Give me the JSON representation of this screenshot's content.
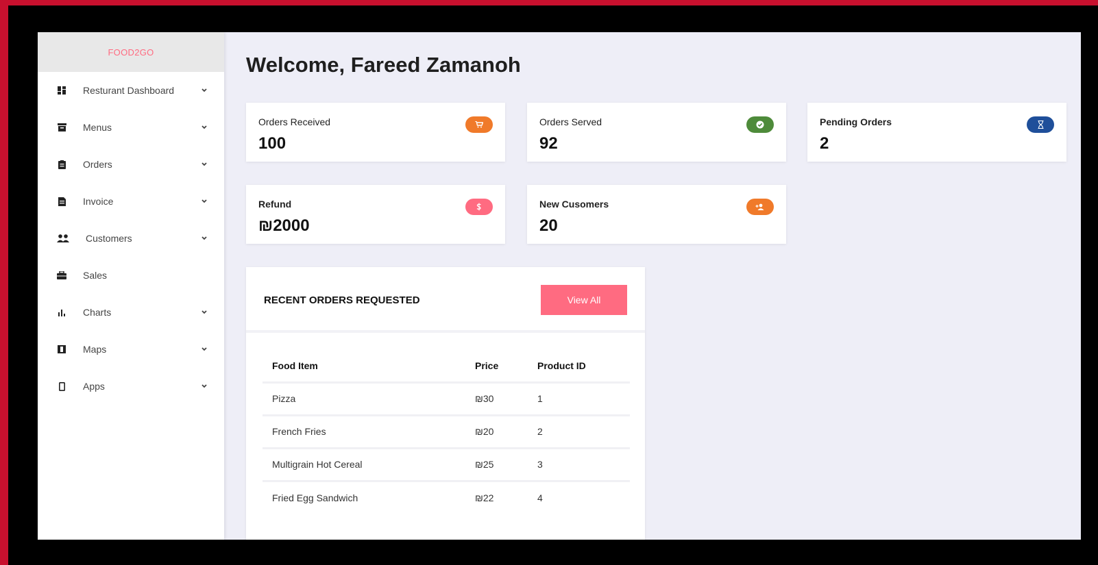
{
  "brand": "FOOD2GO",
  "sidebar": {
    "items": [
      {
        "label": "Resturant Dashboard",
        "icon": "dashboard-icon",
        "chevron": true
      },
      {
        "label": "Menus",
        "icon": "archive-icon",
        "chevron": true
      },
      {
        "label": "Orders",
        "icon": "clipboard-icon",
        "chevron": true
      },
      {
        "label": "Invoice",
        "icon": "invoice-icon",
        "chevron": true
      },
      {
        "label": "Customers",
        "icon": "users-icon",
        "chevron": true
      },
      {
        "label": "Sales",
        "icon": "briefcase-icon",
        "chevron": false
      },
      {
        "label": "Charts",
        "icon": "bar-chart-icon",
        "chevron": true
      },
      {
        "label": "Maps",
        "icon": "map-icon",
        "chevron": true
      },
      {
        "label": "Apps",
        "icon": "mobile-icon",
        "chevron": true
      }
    ]
  },
  "header": {
    "welcome": "Welcome, Fareed Zamanoh"
  },
  "stats": [
    {
      "label": "Orders Received",
      "value": "100",
      "icon": "cart-icon",
      "color": "#f07a2a"
    },
    {
      "label": "Orders Served",
      "value": "92",
      "icon": "check-icon",
      "color": "#4e8b3a"
    },
    {
      "label": "Pending Orders",
      "value": "2",
      "icon": "hourglass-icon",
      "color": "#1f4f9a"
    },
    {
      "label": "Refund",
      "value": "₪2000",
      "icon": "dollar-icon",
      "color": "#ff6b81"
    },
    {
      "label": "New Cusomers",
      "value": "20",
      "icon": "add-user-icon",
      "color": "#f07a2a"
    }
  ],
  "recent_orders": {
    "title": "RECENT ORDERS REQUESTED",
    "view_all": "View All",
    "columns": [
      "Food Item",
      "Price",
      "Product ID"
    ],
    "rows": [
      [
        "Pizza",
        "₪30",
        "1"
      ],
      [
        "French Fries",
        "₪20",
        "2"
      ],
      [
        "Multigrain Hot Cereal",
        "₪25",
        "3"
      ],
      [
        "Fried Egg Sandwich",
        "₪22",
        "4"
      ]
    ]
  },
  "colors": {
    "accent": "#ff6b81",
    "frame": "#c8102e",
    "background": "#eeeef7"
  }
}
